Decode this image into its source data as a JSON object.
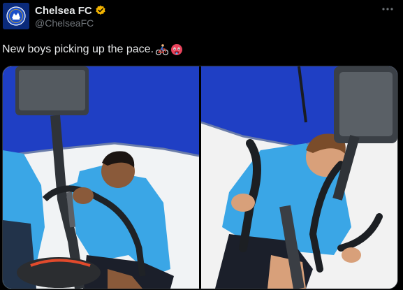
{
  "post": {
    "author": {
      "display_name": "Chelsea FC",
      "handle": "@ChelseaFC",
      "verified": true,
      "verified_color": "#f4b400",
      "avatar_icon": "chelsea-crest-icon"
    },
    "text": "New boys picking up the pace.",
    "emojis": [
      "cyclist-emoji",
      "hot-face-emoji"
    ],
    "more_icon": "more-options-icon",
    "media": [
      {
        "name": "photo-left",
        "description_icon": "player-on-bike-photo"
      },
      {
        "name": "photo-right",
        "description_icon": "player-on-bike-photo"
      }
    ]
  },
  "colors": {
    "background": "#000000",
    "text_primary": "#e7e9ea",
    "text_secondary": "#71767b",
    "canopy_blue": "#1f3fc4",
    "kit_blue": "#3aa6e6"
  }
}
